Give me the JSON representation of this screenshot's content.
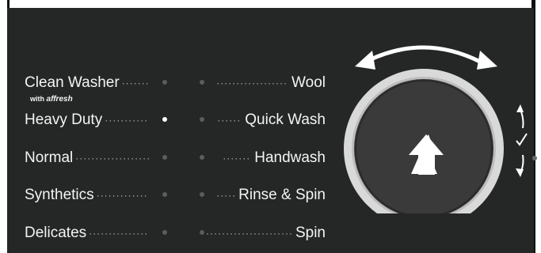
{
  "cycles_left": [
    {
      "label": "Clean Washer",
      "sub_label": "with",
      "sub_brand": "affresh",
      "selected": false
    },
    {
      "label": "Heavy Duty",
      "selected": true
    },
    {
      "label": "Normal",
      "selected": false
    },
    {
      "label": "Synthetics",
      "selected": false
    },
    {
      "label": "Delicates",
      "selected": false
    }
  ],
  "cycles_right": [
    {
      "label": "Wool",
      "selected": false
    },
    {
      "label": "Quick Wash",
      "selected": false
    },
    {
      "label": "Handwash",
      "selected": false
    },
    {
      "label": "Rinse & Spin",
      "selected": false
    },
    {
      "label": "Spin",
      "selected": false
    }
  ],
  "dial": {
    "icon": "start-arrow-icon",
    "rotate_icon": "rotate-arrows-icon",
    "side_icon": "adjust-check-icon"
  },
  "colors": {
    "panel": "#252626",
    "text": "#f4f4f4",
    "indicator_on": "#ffffff",
    "indicator_off": "#5c5c5c",
    "knob_ring": "#d9d9d9",
    "knob_face": "#3a3a3a"
  }
}
